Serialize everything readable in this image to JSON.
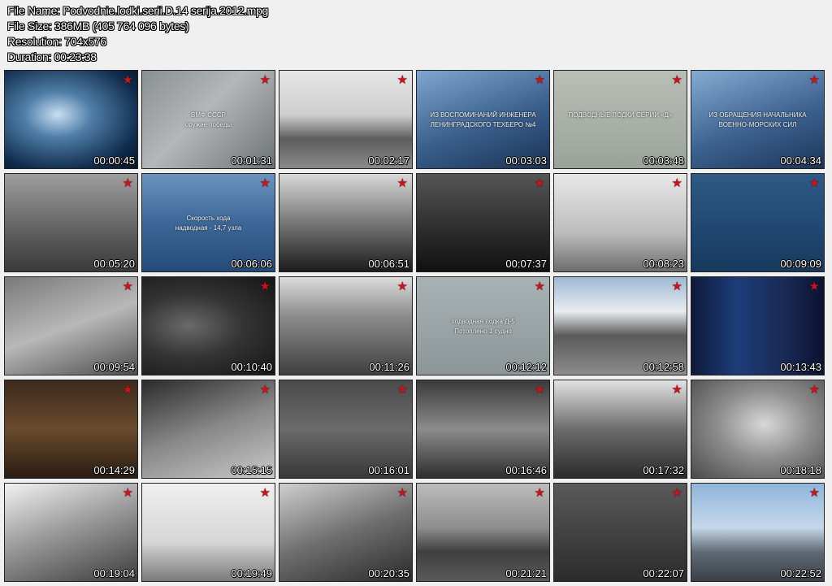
{
  "file_info": {
    "name": "File Name: Podvodnie.lodki.serii.D.14 serija.2012.mpg",
    "size": "File Size: 386MB (405 764 096 bytes)",
    "resolution": "Resolution: 704x576",
    "duration": "Duration: 00:23:38"
  },
  "accent_color": "#c8141e",
  "thumbnails": [
    {
      "time": "00:00:45",
      "bg": "radial-gradient(ellipse at 40% 45%, #c9dff3 0%, #4f7ea8 30%, #0f2a4a 75%, #06152a 100%)"
    },
    {
      "time": "00:01:31",
      "bg": "linear-gradient(135deg, #8a8f92 0%, #b3b7b9 45%, #6e7376 100%)",
      "caption": "ВМФ СССР",
      "caption2": "оружие победы"
    },
    {
      "time": "00:02:17",
      "bg": "linear-gradient(180deg, #e6e6e6 0%, #cfcfcf 45%, #5d5d5d 70%, #8a8a8a 100%)"
    },
    {
      "time": "00:03:03",
      "bg": "linear-gradient(160deg, #7fa6d0 0%, #3a5f8c 55%, #1a3356 100%)",
      "caption": "ИЗ ВОСПОМИНАНИЙ ИНЖЕНЕРА",
      "caption2": "ЛЕНИНГРАДСКОГО ТЕХБЕРО №4"
    },
    {
      "time": "00:03:48",
      "bg": "linear-gradient(180deg, #b9bfb7 0%, #9aa39a 100%)",
      "caption": "ПОДВОДНЫЕ ЛОДКИ СЕРИИ «Д»"
    },
    {
      "time": "00:04:34",
      "bg": "linear-gradient(160deg, #86abd3 0%, #3d6290 55%, #1c355a 100%)",
      "caption": "ИЗ ОБРАЩЕНИЯ НАЧАЛЬНИКА",
      "caption2": "ВОЕННО-МОРСКИХ СИЛ"
    },
    {
      "time": "00:05:20",
      "bg": "linear-gradient(180deg, #9e9e9e 0%, #5e5e5e 60%, #3a3a3a 100%)"
    },
    {
      "time": "00:06:06",
      "bg": "linear-gradient(180deg, #6c93be 0%, #3c6798 50%, #254b78 100%)",
      "caption": "Скорость хода",
      "caption2": "надводная - 14,7 узла"
    },
    {
      "time": "00:06:51",
      "bg": "linear-gradient(180deg, #d8d8d8 0%, #777 50%, #1c1c1c 100%)"
    },
    {
      "time": "00:07:37",
      "bg": "linear-gradient(180deg, #555 0%, #2b2b2b 60%, #111 100%)"
    },
    {
      "time": "00:08:23",
      "bg": "linear-gradient(180deg, #e8e8e8 0%, #bdbdbd 60%, #6d6d6d 100%)"
    },
    {
      "time": "00:09:09",
      "bg": "linear-gradient(180deg, #2e5a84 0%, #1f4670 60%, #17395e 100%)"
    },
    {
      "time": "00:09:54",
      "bg": "linear-gradient(160deg, #7a7a7a 0%, #b8b8b8 50%, #4d4d4d 100%)"
    },
    {
      "time": "00:10:40",
      "bg": "radial-gradient(ellipse at 35% 50%, #6a6a6a 0%, #343434 45%, #151515 100%)"
    },
    {
      "time": "00:11:26",
      "bg": "linear-gradient(180deg, #dcdcdc 0%, #8c8c8c 40%, #3f3f3f 100%)"
    },
    {
      "time": "00:12:12",
      "bg": "linear-gradient(180deg, #a9b2b4 0%, #8c9597 100%)",
      "caption": "подводная лодка Д-5",
      "caption2": "Потоплено 1 судно"
    },
    {
      "time": "00:12:58",
      "bg": "linear-gradient(180deg, #9fb8d3 0%, #e9edf0 35%, #5a5a5a 60%, #8c8c8c 100%)"
    },
    {
      "time": "00:13:43",
      "bg": "linear-gradient(90deg, #0e1a3a 0%, #1d3d7a 35%, #1a2a55 70%, #0a1230 100%)"
    },
    {
      "time": "00:14:29",
      "bg": "linear-gradient(180deg, #3b2a1e 0%, #6a4b2e 50%, #2a1c12 100%)"
    },
    {
      "time": "00:15:15",
      "bg": "linear-gradient(160deg, #2b2b2b 0%, #888 50%, #c9c9c9 100%)"
    },
    {
      "time": "00:16:01",
      "bg": "linear-gradient(180deg, #4a4a4a 0%, #6b6b6b 50%, #383838 100%)"
    },
    {
      "time": "00:16:46",
      "bg": "linear-gradient(180deg, #3a3a3a 0%, #8c8c8c 50%, #2e2e2e 100%)"
    },
    {
      "time": "00:17:32",
      "bg": "linear-gradient(180deg, #e3e3e3 0%, #6c6c6c 50%, #2b2b2b 100%)"
    },
    {
      "time": "00:18:18",
      "bg": "radial-gradient(ellipse at 55% 45%, #d8d8d8 0%, #8e8e8e 45%, #4a4a4a 100%)"
    },
    {
      "time": "00:19:04",
      "bg": "linear-gradient(160deg, #f2f2f2 0%, #9c9c9c 45%, #3d3d3d 100%)"
    },
    {
      "time": "00:19:49",
      "bg": "linear-gradient(180deg, #efefef 0%, #d6d6d6 60%, #7a7a7a 100%)"
    },
    {
      "time": "00:20:35",
      "bg": "linear-gradient(160deg, #cfcfcf 0%, #6f6f6f 50%, #2b2b2b 100%)"
    },
    {
      "time": "00:21:21",
      "bg": "linear-gradient(180deg, #bcbcbc 0%, #8e8e8e 45%, #3f3f3f 70%, #5a5a5a 100%)"
    },
    {
      "time": "00:22:07",
      "bg": "linear-gradient(180deg, #5a5a5a 0%, #3e3e3e 60%, #2c2c2c 100%)"
    },
    {
      "time": "00:22:52",
      "bg": "linear-gradient(180deg, #8fb5dc 0%, #c6d8ea 45%, #5f6a74 70%, #3a4048 100%)"
    }
  ]
}
